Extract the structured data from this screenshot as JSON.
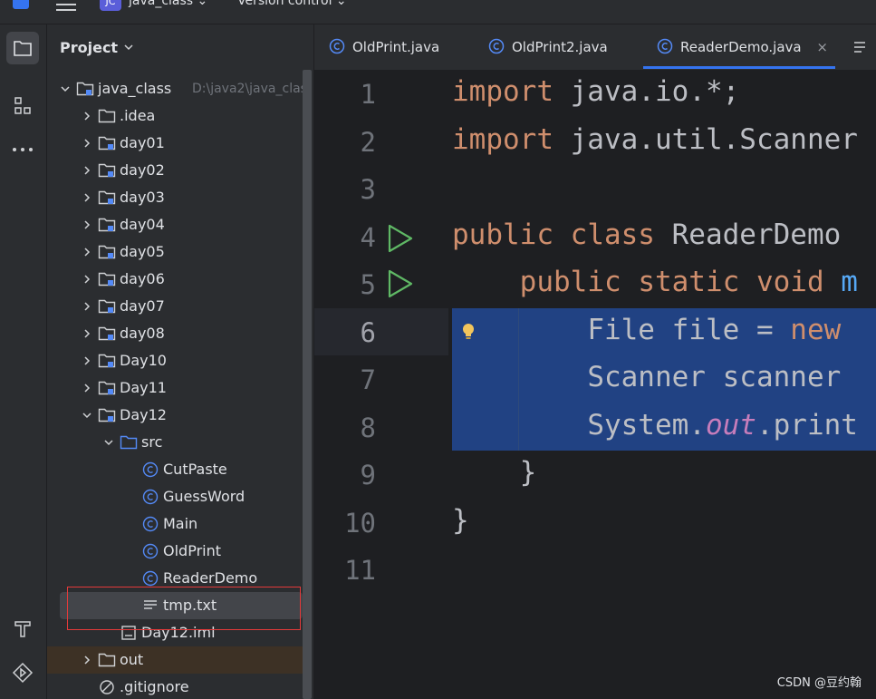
{
  "topbar": {
    "project_badge": "JC",
    "project_name": "java_class",
    "vcs_label": "Version control"
  },
  "project_panel": {
    "title": "Project",
    "tree": [
      {
        "label": "java_class",
        "hint": "D:\\java2\\java_clas",
        "type": "module",
        "expanded": true
      },
      {
        "label": ".idea",
        "type": "folder"
      },
      {
        "label": "day01",
        "type": "module"
      },
      {
        "label": "day02",
        "type": "module"
      },
      {
        "label": "day03",
        "type": "module"
      },
      {
        "label": "day04",
        "type": "module"
      },
      {
        "label": "day05",
        "type": "module"
      },
      {
        "label": "day06",
        "type": "module"
      },
      {
        "label": "day07",
        "type": "module"
      },
      {
        "label": "day08",
        "type": "module"
      },
      {
        "label": "Day10",
        "type": "module"
      },
      {
        "label": "Day11",
        "type": "module"
      },
      {
        "label": "Day12",
        "type": "module",
        "expanded": true
      },
      {
        "label": "src",
        "type": "source-folder",
        "expanded": true
      },
      {
        "label": "CutPaste",
        "type": "class"
      },
      {
        "label": "GuessWord",
        "type": "class"
      },
      {
        "label": "Main",
        "type": "class"
      },
      {
        "label": "OldPrint",
        "type": "class"
      },
      {
        "label": "ReaderDemo",
        "type": "class"
      },
      {
        "label": "tmp.txt",
        "type": "text-file",
        "selected": true
      },
      {
        "label": "Day12.iml",
        "type": "iml-file"
      },
      {
        "label": "out",
        "type": "folder"
      },
      {
        "label": ".gitignore",
        "type": "ignore-file"
      }
    ]
  },
  "tabs": [
    {
      "label": "OldPrint.java"
    },
    {
      "label": "OldPrint2.java"
    },
    {
      "label": "ReaderDemo.java",
      "active": true,
      "close": "×"
    }
  ],
  "editor": {
    "line_numbers": [
      "1",
      "2",
      "3",
      "4",
      "5",
      "6",
      "7",
      "8",
      "9",
      "10",
      "11"
    ],
    "current_line": 6,
    "lines": {
      "l1": {
        "kw": "import",
        "rest": " java.io.*;"
      },
      "l2": {
        "kw": "import",
        "rest": " java.util.Scanner"
      },
      "l4": {
        "kw1": "public",
        "kw2": "class",
        "rest": " ReaderDemo"
      },
      "l5": {
        "indent": "    ",
        "kw1": "public",
        "kw2": "static",
        "kw3": "void",
        "fn": "m"
      },
      "l6": {
        "indent": "        ",
        "text": "File file = ",
        "kw": "new"
      },
      "l7": {
        "indent": "        ",
        "text": "Scanner scanner"
      },
      "l8": {
        "indent": "        ",
        "text": "System.",
        "fld": "out",
        "rest": ".print"
      },
      "l9": {
        "indent": "    ",
        "text": "}"
      },
      "l10": {
        "text": "}"
      }
    }
  },
  "colors": {
    "keyword": "#cf8e6d",
    "selection": "#214283",
    "static_field": "#c77dbb",
    "run_icon": "#5fb865",
    "class_icon": "#548af7"
  },
  "watermark": "CSDN @豆约翰"
}
